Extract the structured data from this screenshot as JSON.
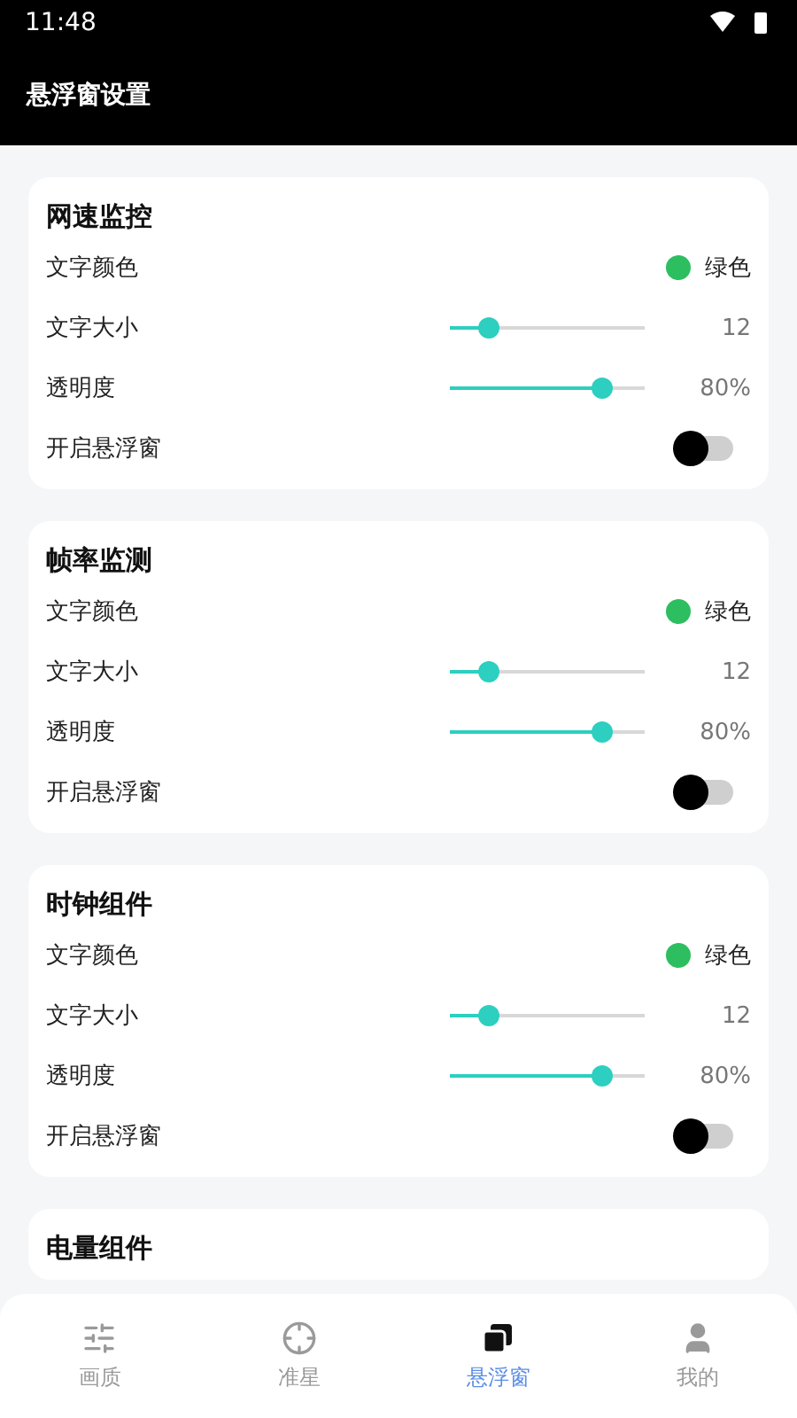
{
  "status_bar": {
    "time": "11:48"
  },
  "header": {
    "title": "悬浮窗设置"
  },
  "cards": [
    {
      "title": "网速监控",
      "rows": [
        {
          "kind": "color",
          "label": "文字颜色",
          "color": "#2dbe60",
          "value": "绿色"
        },
        {
          "kind": "slider",
          "label": "文字大小",
          "level": 0.2,
          "value": "12"
        },
        {
          "kind": "slider",
          "label": "透明度",
          "level": 0.78,
          "value": "80%"
        },
        {
          "kind": "switch",
          "label": "开启悬浮窗",
          "on": false
        }
      ]
    },
    {
      "title": "帧率监测",
      "rows": [
        {
          "kind": "color",
          "label": "文字颜色",
          "color": "#2dbe60",
          "value": "绿色"
        },
        {
          "kind": "slider",
          "label": "文字大小",
          "level": 0.2,
          "value": "12"
        },
        {
          "kind": "slider",
          "label": "透明度",
          "level": 0.78,
          "value": "80%"
        },
        {
          "kind": "switch",
          "label": "开启悬浮窗",
          "on": false
        }
      ]
    },
    {
      "title": "时钟组件",
      "rows": [
        {
          "kind": "color",
          "label": "文字颜色",
          "color": "#2dbe60",
          "value": "绿色"
        },
        {
          "kind": "slider",
          "label": "文字大小",
          "level": 0.2,
          "value": "12"
        },
        {
          "kind": "slider",
          "label": "透明度",
          "level": 0.78,
          "value": "80%"
        },
        {
          "kind": "switch",
          "label": "开启悬浮窗",
          "on": false
        }
      ]
    },
    {
      "title": "电量组件"
    }
  ],
  "nav": [
    {
      "kind": "quality",
      "label": "画质",
      "selected": false
    },
    {
      "kind": "crosshair",
      "label": "准星",
      "selected": false
    },
    {
      "kind": "float",
      "label": "悬浮窗",
      "selected": true
    },
    {
      "kind": "user",
      "label": "我的",
      "selected": false
    }
  ]
}
